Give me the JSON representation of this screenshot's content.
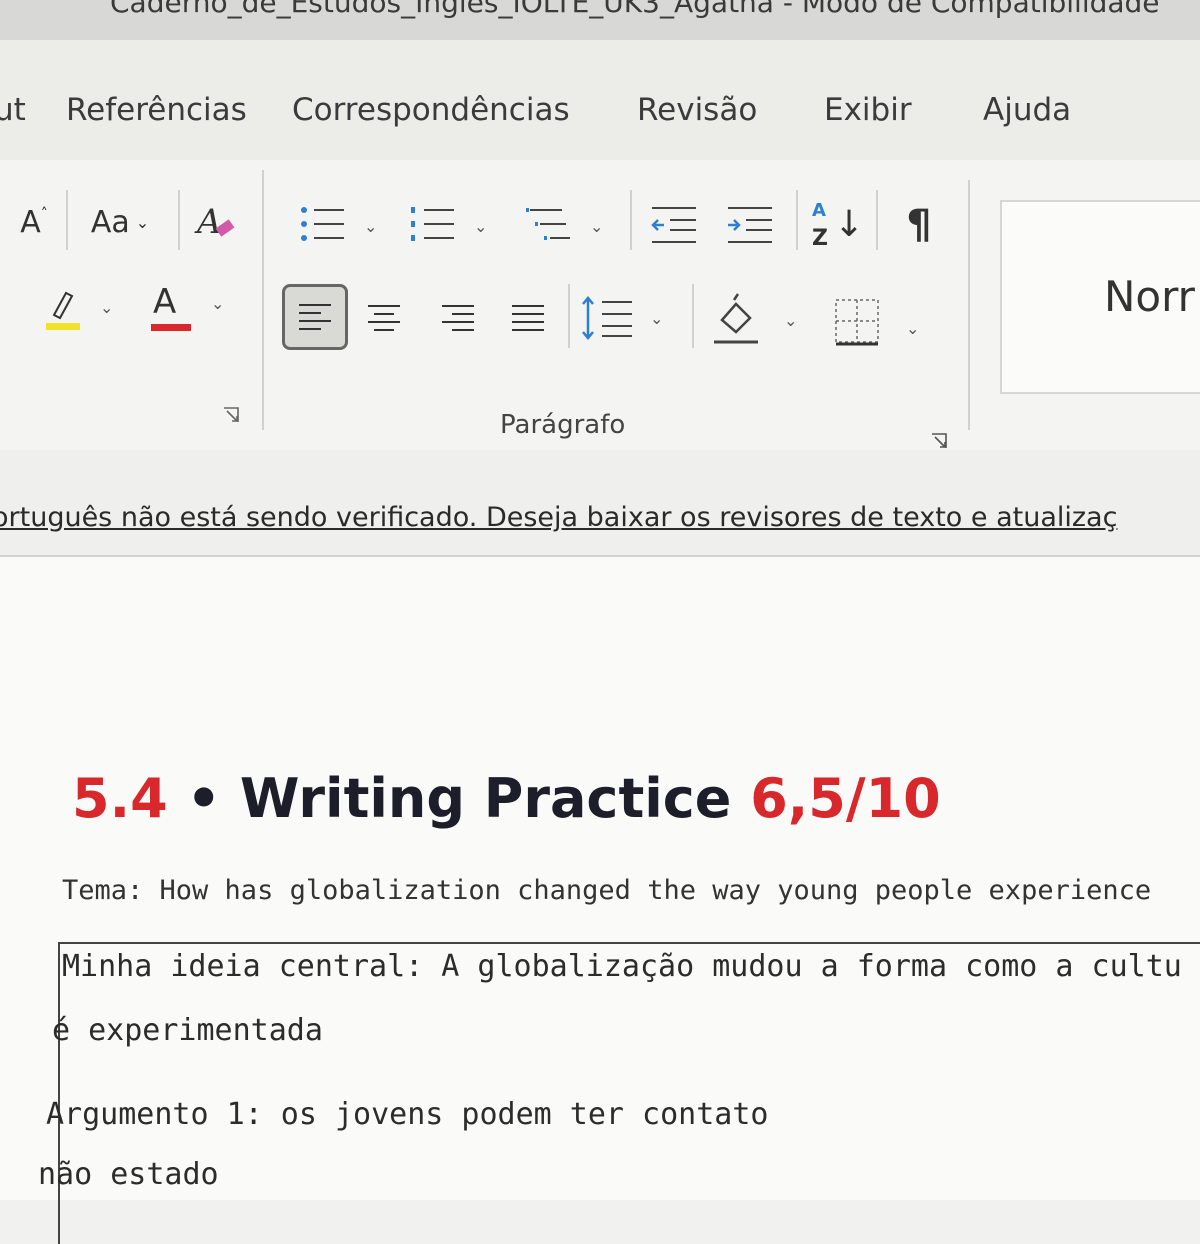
{
  "window": {
    "title": "Caderno_de_Estudos_Inglês_IOLTE_UK3_Agatha  -  Modo de Compatibilidade"
  },
  "ribbon_tabs": [
    "ut",
    "Referências",
    "Correspondências",
    "Revisão",
    "Exibir",
    "Ajuda"
  ],
  "font_group": {
    "grow_font": "A",
    "change_case": "Aa",
    "font_color_letter": "A",
    "highlight_color": "#f1e12a",
    "font_color": "#d8282b"
  },
  "paragraph_group": {
    "label": "Parágrafo",
    "sort_top": "A",
    "sort_bottom": "Z",
    "pilcrow": "¶"
  },
  "styles": {
    "normal_label": "Norr"
  },
  "info_bar": {
    "message": "ortuguês não está sendo verificado. Deseja baixar os revisores de texto e atualizaç"
  },
  "document": {
    "heading_number": "5.4",
    "heading_bullet": "•",
    "heading_text": "Writing Practice",
    "heading_score": "6,5/10",
    "tema": "Tema: How has globalization changed the way young people experience",
    "lines": [
      "Minha ideia central: A globalização mudou a forma como a cultu",
      "é experimentada",
      "Argumento 1: os jovens podem ter contato",
      "não estado"
    ]
  },
  "colors": {
    "accent_red": "#d8282b",
    "icon_blue": "#2f7fd0"
  }
}
